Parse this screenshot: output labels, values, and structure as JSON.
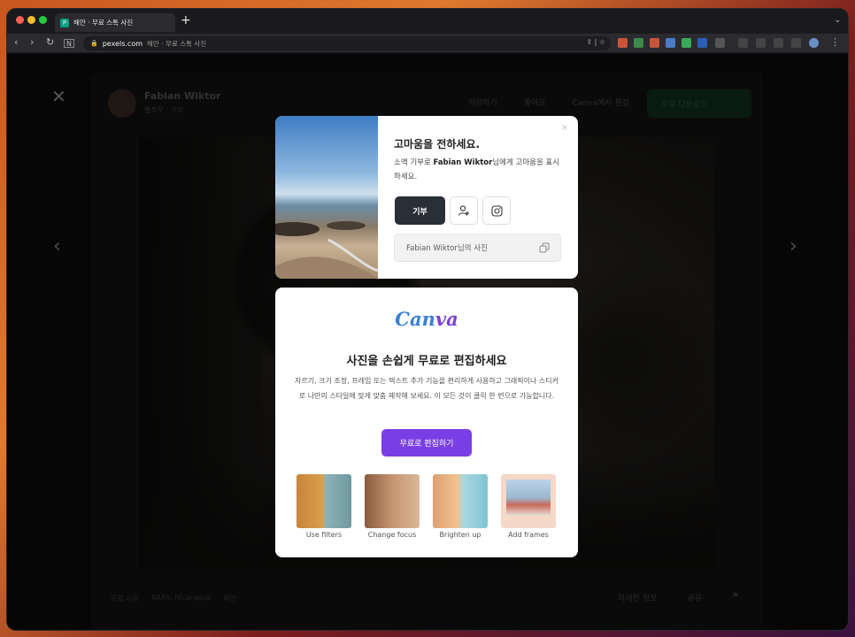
{
  "browser": {
    "tab_title": "해안 · 무료 스톡 사진",
    "new_tab": "+",
    "url_host": "pexels.com",
    "url_rest": "해안 · 무료 스톡 사진"
  },
  "page": {
    "author_name": "Fabian Wiktor",
    "follow_text": "팔로우 · 기부",
    "actions": [
      "저장하기",
      "좋아요",
      "Canva에서 편집"
    ],
    "download": "무료 다운로드",
    "meta": [
      "무료 사용",
      "RAAS, Nicaragua",
      "해안"
    ],
    "bottom_actions": [
      "자세한 정보",
      "공유"
    ]
  },
  "thanks_card": {
    "title": "고마움을 전하세요.",
    "desc_prefix": "소액 기부로 ",
    "desc_name": "Fabian Wiktor",
    "desc_suffix": "님에게 고마움을 표시하세요.",
    "donate": "기부",
    "credit": "Fabian Wiktor님의 사진",
    "close": "×"
  },
  "canva_card": {
    "logo_a": "Can",
    "logo_b": "va",
    "title": "사진을 손쉽게 무료로 편집하세요",
    "desc": "자르기, 크기 조정, 프레임 또는 텍스트 추가 기능을 편리하게 사용하고 그래픽이나 스티커로 나만의 스타일에 맞게 맞춤 제작해 보세요. 이 모든 것이 클릭 한 번으로 가능합니다.",
    "cta": "무료로 편집하기",
    "features": [
      "Use filters",
      "Change focus",
      "Brighten up",
      "Add frames"
    ]
  },
  "colors": {
    "canva_purple": "#7a3fe4",
    "donate_dark": "#2a2e36",
    "pexels_green": "#05a081"
  }
}
